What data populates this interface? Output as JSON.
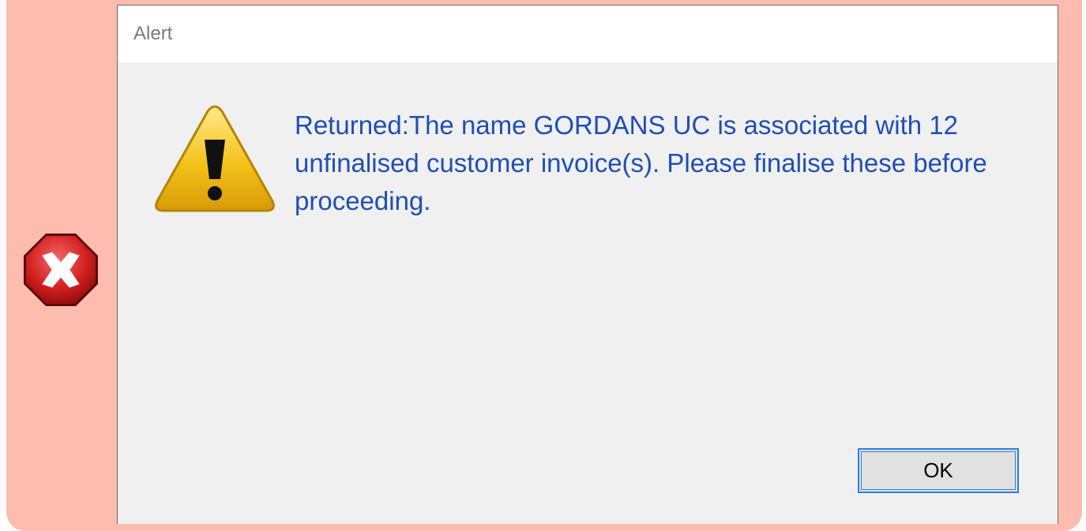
{
  "dialog": {
    "title": "Alert",
    "message": "Returned:The name GORDANS UC is associated with 12 unfinalised customer invoice(s). Please finalise these before proceeding.",
    "ok_label": "OK"
  },
  "icons": {
    "dialog_icon": "warning-icon",
    "annotation_icon": "error-icon"
  },
  "colors": {
    "callout_background": "#fdbcae",
    "message_text": "#1f4fb4",
    "button_focus_border": "#2b7fd9"
  }
}
